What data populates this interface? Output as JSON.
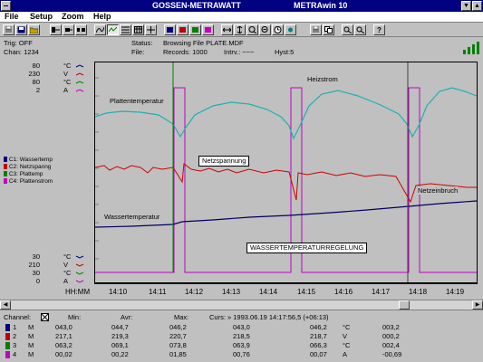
{
  "window": {
    "title_left": "GOSSEN-METRAWATT",
    "title_right": "METRAwin 10",
    "min_btn": "▼",
    "max_btn": "▲"
  },
  "menu": [
    "File",
    "Setup",
    "Zoom",
    "Help"
  ],
  "status": {
    "trig": "Trig: OFF",
    "chan": "Chan:  1234",
    "status_label": "Status:",
    "status_value": "Browsing File PLATE.MDF",
    "file_label": "File:",
    "records": "Records: 1000",
    "intrv": "Intrv.: ~~~",
    "hyst": "Hyst:5"
  },
  "scale_top": [
    {
      "value": "80",
      "unit": "°C"
    },
    {
      "value": "230",
      "unit": "V"
    },
    {
      "value": "80",
      "unit": "°C"
    },
    {
      "value": "2",
      "unit": "A"
    }
  ],
  "scale_bottom": [
    {
      "value": "30",
      "unit": "°C"
    },
    {
      "value": "210",
      "unit": "V"
    },
    {
      "value": "30",
      "unit": "°C"
    },
    {
      "value": "0",
      "unit": "A"
    }
  ],
  "legend": [
    {
      "label": "C1: Wassertemp",
      "color": "#000080"
    },
    {
      "label": "C2: Netzspanng",
      "color": "#c00000"
    },
    {
      "label": "C3: Plattemp",
      "color": "#008000"
    },
    {
      "label": "C4: Plattenstrom",
      "color": "#c000c0"
    }
  ],
  "annotations": {
    "platten": "Plattentemperatur",
    "heiz": "Heizstrom",
    "netz": "Netzspannung",
    "netzein": "Netzeinbruch",
    "wasser": "Wassertemperatur",
    "regel": "WASSERTEMPERATURREGELUNG"
  },
  "time_axis": {
    "label": "HH:MM",
    "ticks": [
      "14:10",
      "14:11",
      "14:12",
      "14:13",
      "14:14",
      "14:15",
      "14:16",
      "14:17",
      "14:18",
      "14:19"
    ]
  },
  "table": {
    "headers": {
      "channel": "Channel:",
      "min": "Min:",
      "avr": "Avr:",
      "max": "Max:",
      "curs": "Curs: » 1993.06.19  14:17:56,5 (+06:13)"
    },
    "rows": [
      {
        "num": "1",
        "mode": "M",
        "min": "043,0",
        "avr": "044,7",
        "max": "046,2",
        "cur": "043,0",
        "cur2": "046,2",
        "unit": "°C",
        "delta": "003,2",
        "color": "#000080"
      },
      {
        "num": "2",
        "mode": "M",
        "min": "217,1",
        "avr": "219,3",
        "max": "220,7",
        "cur": "218,5",
        "cur2": "218,7",
        "unit": "V",
        "delta": "000,2",
        "color": "#c00000"
      },
      {
        "num": "3",
        "mode": "M",
        "min": "063,2",
        "avr": "069,1",
        "max": "073,8",
        "cur": "063,9",
        "cur2": "066,3",
        "unit": "°C",
        "delta": "002,4",
        "color": "#008000"
      },
      {
        "num": "4",
        "mode": "M",
        "min": "00,02",
        "avr": "00,22",
        "max": "01,85",
        "cur": "00,76",
        "cur2": "00,07",
        "unit": "A",
        "delta": "-00,69",
        "color": "#c000c0"
      }
    ]
  }
}
